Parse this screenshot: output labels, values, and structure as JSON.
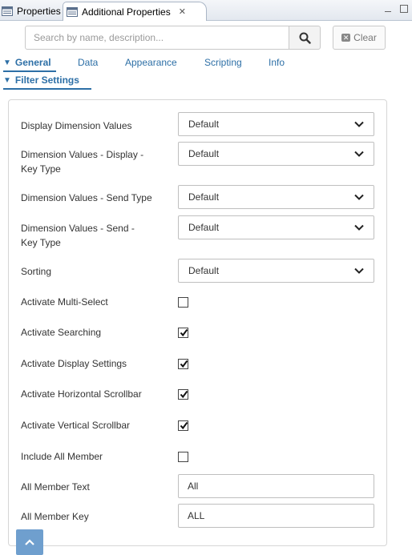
{
  "tabs": [
    {
      "label": "Properties",
      "active": false
    },
    {
      "label": "Additional Properties",
      "active": true,
      "close_icon": "close-icon"
    }
  ],
  "search": {
    "placeholder": "Search by name, description...",
    "value": ""
  },
  "clear_label": "Clear",
  "nav_tabs": [
    "General",
    "Data",
    "Appearance",
    "Scripting",
    "Info"
  ],
  "section_title": "Filter Settings",
  "fields": {
    "display_dimension_values": {
      "label": "Display Dimension Values",
      "value": "Default"
    },
    "dim_display_key_type": {
      "label_line1": "Dimension Values - Display -",
      "label_line2": "Key Type",
      "value": "Default"
    },
    "dim_send_type": {
      "label": "Dimension Values - Send Type",
      "value": "Default"
    },
    "dim_send_key_type": {
      "label_line1": "Dimension Values - Send -",
      "label_line2": "Key Type",
      "value": "Default"
    },
    "sorting": {
      "label": "Sorting",
      "value": "Default"
    },
    "activate_multi_select": {
      "label": "Activate Multi-Select",
      "checked": false
    },
    "activate_searching": {
      "label": "Activate Searching",
      "checked": true
    },
    "activate_display_settings": {
      "label": "Activate Display Settings",
      "checked": true
    },
    "activate_horizontal_scrollbar": {
      "label": "Activate Horizontal Scrollbar",
      "checked": true
    },
    "activate_vertical_scrollbar": {
      "label": "Activate Vertical Scrollbar",
      "checked": true
    },
    "include_all_member": {
      "label": "Include All Member",
      "checked": false
    },
    "all_member_text": {
      "label": "All Member Text",
      "value": "All"
    },
    "all_member_key": {
      "label": "All Member Key",
      "value": "ALL"
    }
  },
  "colors": {
    "accent": "#2d6fa6",
    "scroll_button": "#6f9fce"
  }
}
